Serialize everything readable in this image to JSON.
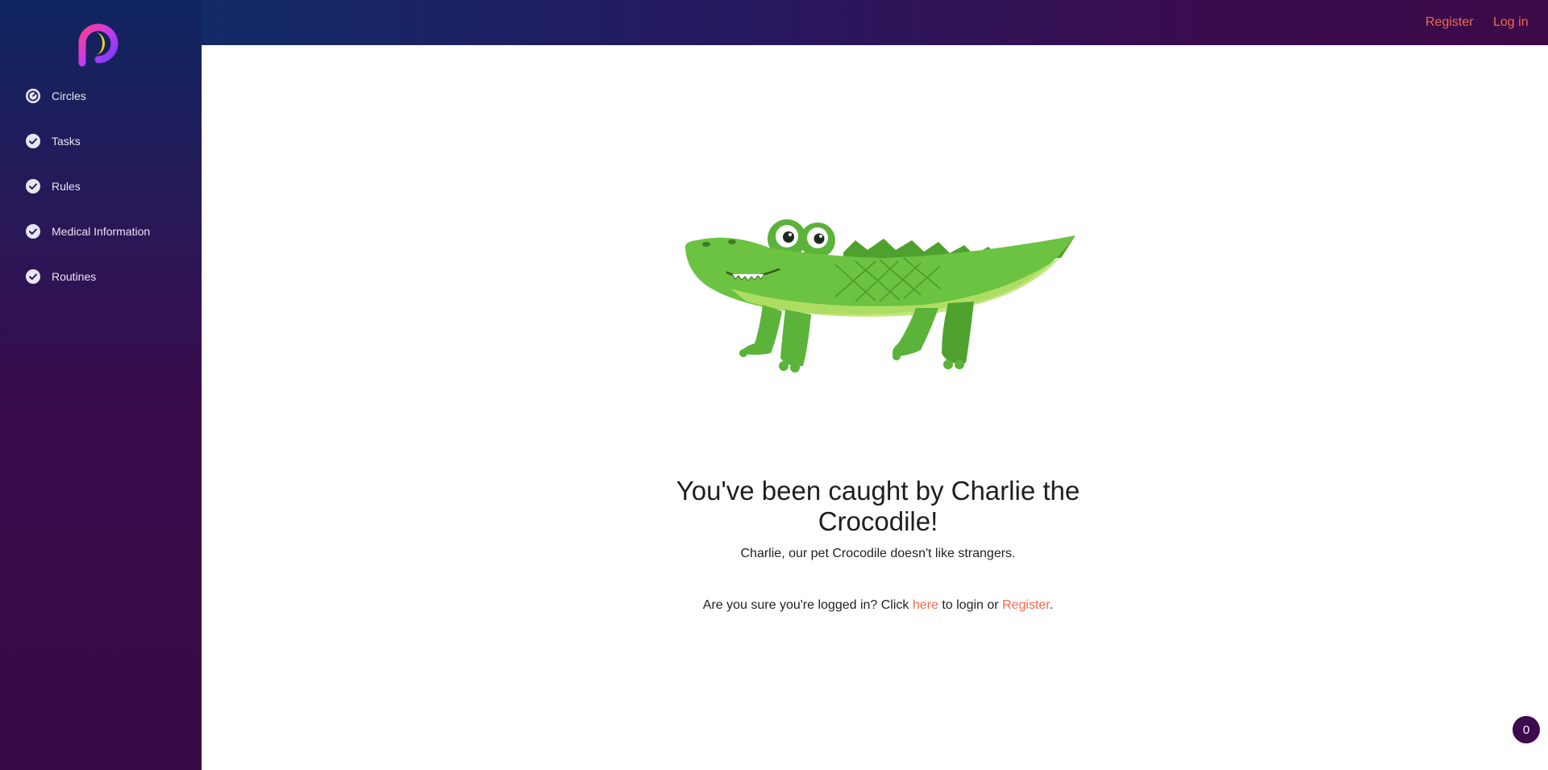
{
  "sidebar": {
    "logo_icon": "app-logo-icon",
    "items": [
      {
        "label": "Circles",
        "icon": "gauge-icon"
      },
      {
        "label": "Tasks",
        "icon": "check-circle-icon"
      },
      {
        "label": "Rules",
        "icon": "check-circle-icon"
      },
      {
        "label": "Medical Information",
        "icon": "check-circle-icon"
      },
      {
        "label": "Routines",
        "icon": "check-circle-icon"
      }
    ]
  },
  "header": {
    "register_label": "Register",
    "login_label": "Log in"
  },
  "main": {
    "illustration": "crocodile-illustration",
    "heading": "You've been caught by Charlie the Crocodile!",
    "subtext": "Charlie, our pet Crocodile doesn't like strangers.",
    "prompt_prefix": "Are you sure you're logged in? Click ",
    "prompt_here": "here",
    "prompt_middle": " to login or ",
    "prompt_register": "Register",
    "prompt_suffix": "."
  },
  "badge": {
    "count": "0"
  },
  "colors": {
    "accent": "#f26b4d",
    "sidebar_top": "#0f2560",
    "sidebar_bottom": "#3a0a48",
    "badge_bg": "#3d0a4e"
  }
}
